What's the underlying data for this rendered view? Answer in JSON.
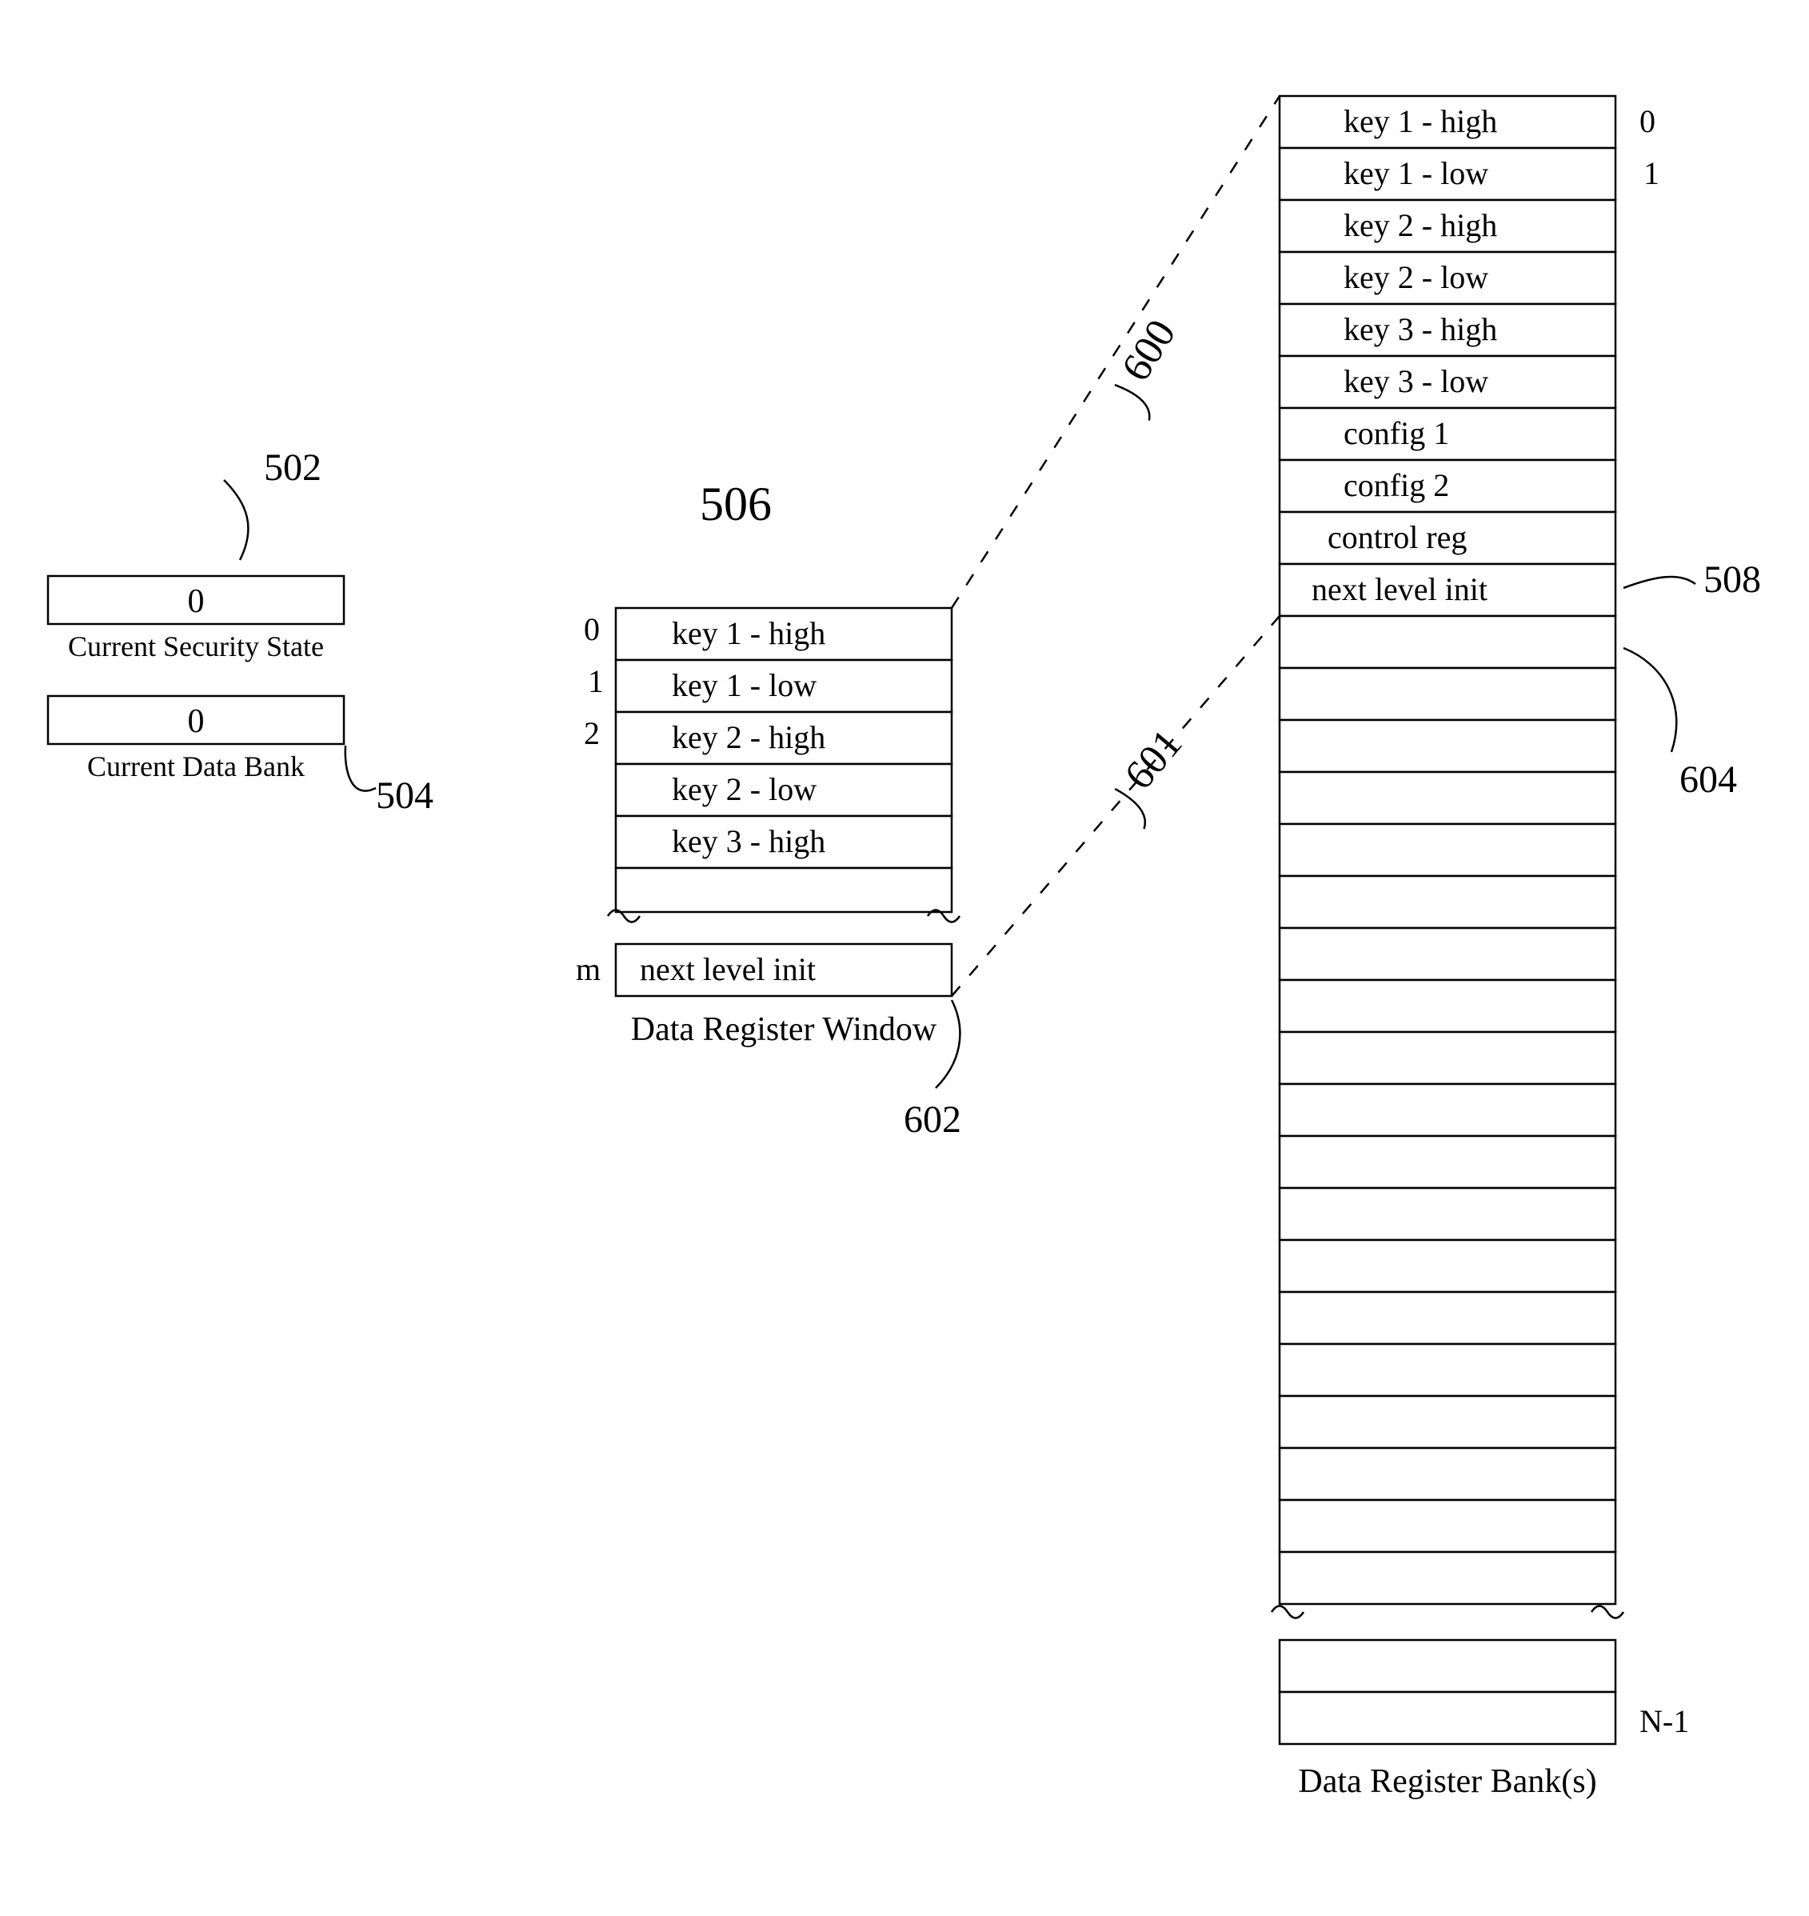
{
  "refs": {
    "r502": "502",
    "r504": "504",
    "r506": "506",
    "r508": "508",
    "r600": "600",
    "r601": "601",
    "r602": "602",
    "r604": "604"
  },
  "left": {
    "security_state": {
      "label": "Current Security State",
      "value": "0"
    },
    "data_bank": {
      "label": "Current Data Bank",
      "value": "0"
    }
  },
  "window": {
    "caption": "Data Register Window",
    "indices": {
      "i0": "0",
      "i1": "1",
      "i2": "2",
      "im": "m"
    },
    "rows": {
      "r0": "key 1 - high",
      "r1": "key 1 - low",
      "r2": "key 2 - high",
      "r3": "key 2 - low",
      "r4": "key 3 - high",
      "rm": "next level init"
    }
  },
  "bank": {
    "caption": "Data Register Bank(s)",
    "indices": {
      "i0": "0",
      "i1": "1",
      "in": "N-1"
    },
    "rows": {
      "r0": "key 1 - high",
      "r1": "key 1 - low",
      "r2": "key 2 - high",
      "r3": "key 2 - low",
      "r4": "key 3 - high",
      "r5": "key 3 - low",
      "r6": "config 1",
      "r7": "config 2",
      "r8": "control reg",
      "r9": "next level init"
    }
  }
}
